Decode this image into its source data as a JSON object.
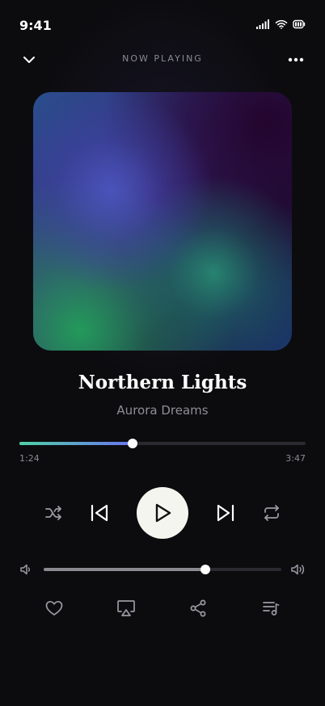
{
  "status": {
    "time": "9:41",
    "icons": [
      "cellular-signal-icon",
      "wifi-icon",
      "battery-icon"
    ]
  },
  "header": {
    "title": "NOW PLAYING",
    "left_icon": "chevron-down-icon",
    "right_icon": "more-horizontal-icon"
  },
  "track": {
    "title": "Northern Lights",
    "artist": "Aurora Dreams"
  },
  "playback": {
    "elapsed": "1:24",
    "total": "3:47",
    "progress_fraction": 0.395,
    "is_playing": false
  },
  "controls": [
    "shuffle-icon",
    "skip-previous-icon",
    "play-icon",
    "skip-next-icon",
    "repeat-icon"
  ],
  "volume": {
    "level_fraction": 0.68
  },
  "actions": [
    "heart-icon",
    "airplay-icon",
    "share-icon",
    "queue-icon"
  ],
  "colors": {
    "background": "#0c0c0f",
    "progress_start": "#4fd1a5",
    "progress_end": "#6a75f0",
    "play_button": "#f5f5f0"
  }
}
